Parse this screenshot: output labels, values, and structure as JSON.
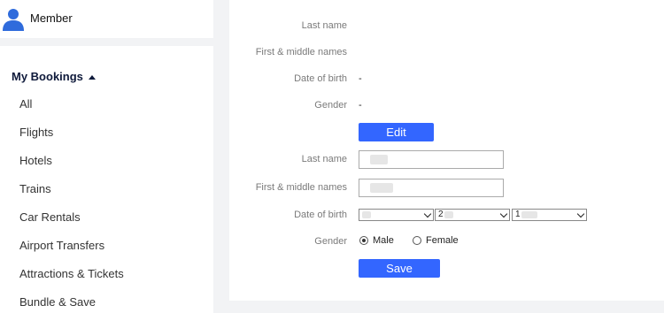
{
  "member": {
    "name": "Member"
  },
  "nav": {
    "heading": "My Bookings",
    "items": [
      "All",
      "Flights",
      "Hotels",
      "Trains",
      "Car Rentals",
      "Airport Transfers",
      "Attractions & Tickets",
      "Bundle & Save"
    ]
  },
  "profile": {
    "labels": {
      "last_name": "Last name",
      "first_middle": "First & middle names",
      "dob": "Date of birth",
      "gender": "Gender"
    },
    "values": {
      "last_name": "",
      "first_middle": "",
      "dob": "-",
      "gender": "-"
    },
    "edit_label": "Edit"
  },
  "form": {
    "last_name_value": "",
    "first_middle_value": "",
    "dob_day": "",
    "dob_month": "2",
    "dob_year": "1",
    "gender_options": [
      "Male",
      "Female"
    ],
    "gender_selected": "Male",
    "save_label": "Save"
  },
  "colors": {
    "primary": "#3366ff",
    "background": "#f2f3f5"
  }
}
